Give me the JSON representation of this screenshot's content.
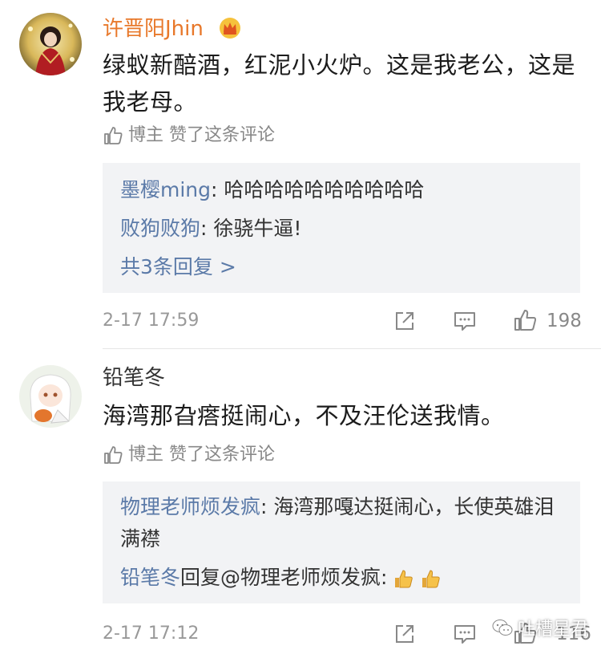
{
  "comments": [
    {
      "username": "许晋阳Jhin",
      "text": "绿蚁新醅酒，红泥小火炉。这是我老公，这是我老母。",
      "liked_label": "博主 赞了这条评论",
      "replies": [
        {
          "name": "墨樱ming",
          "sep": ": ",
          "text": "哈哈哈哈哈哈哈哈哈哈"
        },
        {
          "name": "败狗败狗",
          "sep": ": ",
          "text": "徐骁牛逼!"
        }
      ],
      "more_replies": "共3条回复 >",
      "time": "2-17 17:59",
      "likes": "198"
    },
    {
      "username": "铅笔冬",
      "text": "海湾那旮瘩挺闹心，不及汪伦送我情。",
      "liked_label": "博主 赞了这条评论",
      "replies": [
        {
          "name": "物理老师烦发疯",
          "sep": ": ",
          "text": "海湾那嘎达挺闹心，长使英雄泪满襟"
        },
        {
          "name": "铅笔冬",
          "sep": "",
          "text": "回复@物理老师烦发疯:"
        }
      ],
      "time": "2-17 17:12",
      "likes": "116"
    }
  ],
  "watermark": "吐槽星君",
  "colors": {
    "vip_name": "#e8782a",
    "reply_name": "#5b7aa8",
    "reply_bg": "#f2f3f5",
    "meta": "#999999"
  },
  "icons": [
    "thumbs-up-icon",
    "share-icon",
    "comment-icon",
    "crown-icon",
    "wechat-icon"
  ]
}
